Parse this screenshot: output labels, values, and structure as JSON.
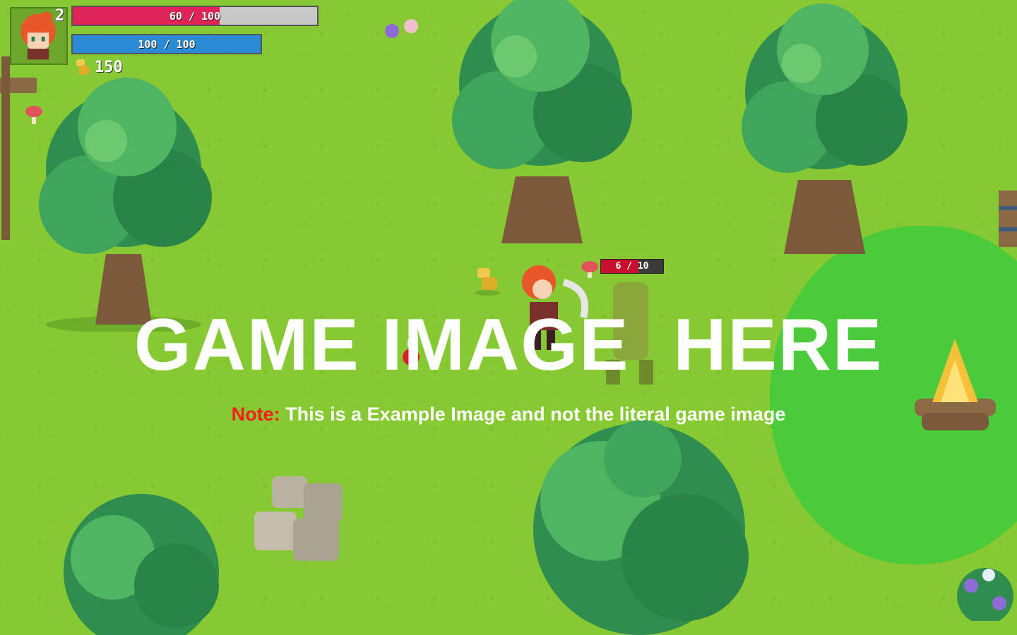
{
  "hud": {
    "level": "2",
    "hp": {
      "text": "60 / 100",
      "current": 60,
      "max": 100
    },
    "mp": {
      "text": "100 / 100",
      "current": 100,
      "max": 100
    },
    "gold": "150",
    "colors": {
      "hp_fill": "#e0245a",
      "hp_empty": "#c8c8c8",
      "mp_fill": "#2a8ad6"
    }
  },
  "enemy": {
    "hp": {
      "text": "6 / 10",
      "current": 6,
      "max": 10
    }
  },
  "overlay": {
    "title": "GAME IMAGE  HERE",
    "note_label": "Note:",
    "note_text": " This is a Example Image and not the literal game image"
  },
  "icons": [
    "player-portrait-icon",
    "gold-coin-icon"
  ]
}
